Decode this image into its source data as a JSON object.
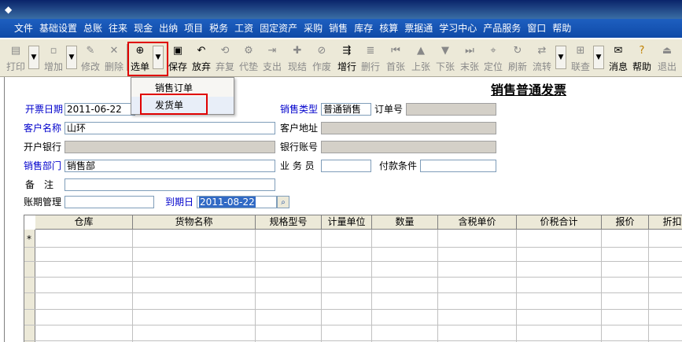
{
  "menubar": {
    "items": [
      "文件",
      "基础设置",
      "总账",
      "往来",
      "现金",
      "出纳",
      "项目",
      "税务",
      "工资",
      "固定资产",
      "采购",
      "销售",
      "库存",
      "核算",
      "票据通",
      "学习中心",
      "产品服务",
      "窗口",
      "帮助"
    ]
  },
  "toolbar": {
    "print": "打印",
    "add": "增加",
    "edit": "修改",
    "delete": "删除",
    "select": "选单",
    "save": "保存",
    "discard": "放弃",
    "restore": "弃复",
    "advance": "代垫",
    "pay": "支出",
    "cash": "现结",
    "void": "作废",
    "add_row": "增行",
    "del_row": "删行",
    "first": "首张",
    "prev": "上张",
    "next": "下张",
    "last": "末张",
    "locate": "定位",
    "refresh": "刷新",
    "transfer": "流转",
    "linked_query": "联查",
    "message": "消息",
    "help": "帮助",
    "exit": "退出"
  },
  "dropdown": {
    "items": [
      "销售订单",
      "发货单"
    ]
  },
  "form": {
    "title": "销售普通发票",
    "invoice_date_label": "开票日期",
    "invoice_date": "2011-06-22",
    "sales_type_label": "销售类型",
    "sales_type": "普通销售",
    "order_no_label": "订单号",
    "order_no": "",
    "customer_label": "客户名称",
    "customer": "山环",
    "customer_address_label": "客户地址",
    "customer_address": "",
    "bank_label": "开户银行",
    "bank": "",
    "bank_account_label": "银行账号",
    "bank_account": "",
    "dept_label": "销售部门",
    "dept": "销售部",
    "salesman_label": "业 务 员",
    "salesman": "",
    "payment_terms_label": "付款条件",
    "payment_terms": "",
    "remark_label": "备　注",
    "remark": "",
    "period_label": "账期管理",
    "period": "",
    "due_date_label": "到期日",
    "due_date": "2011-08-22"
  },
  "grid": {
    "columns": [
      "仓库",
      "货物名称",
      "规格型号",
      "计量单位",
      "数量",
      "含税单价",
      "价税合计",
      "报价",
      "折扣"
    ],
    "new_row_marker": "*"
  }
}
